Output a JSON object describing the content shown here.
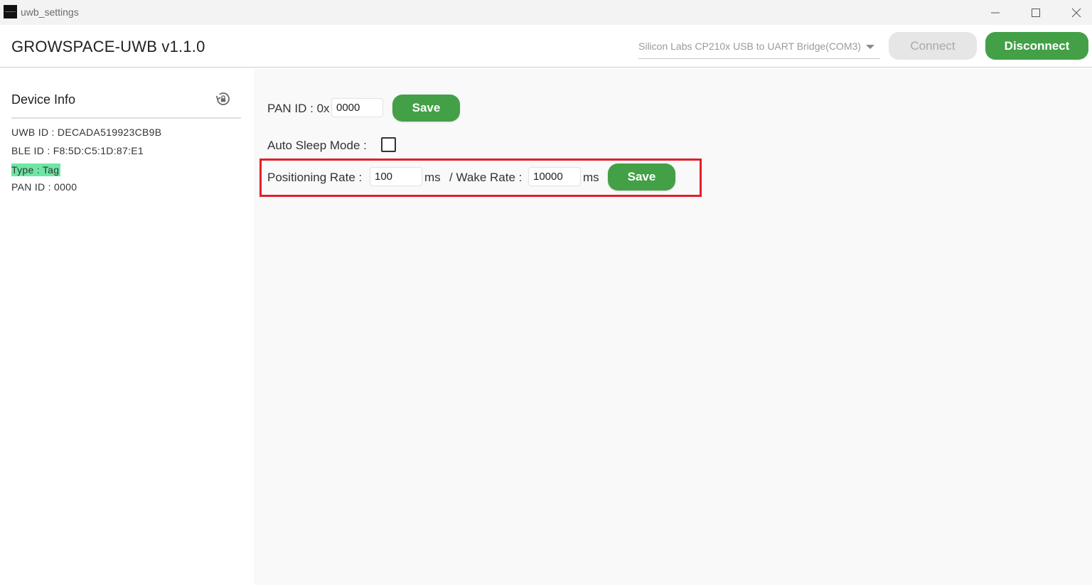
{
  "window": {
    "title": "uwb_settings"
  },
  "header": {
    "app_title": "GROWSPACE-UWB v1.1.0",
    "port_select": {
      "value": "Silicon Labs CP210x USB to UART Bridge(COM3)"
    },
    "connect_label": "Connect",
    "disconnect_label": "Disconnect"
  },
  "sidebar": {
    "title": "Device Info",
    "uwb_id": "UWB ID : DECADA519923CB9B",
    "ble_id": "BLE ID : F8:5D:C5:1D:87:E1",
    "type": "Type : Tag",
    "pan_id": "PAN ID : 0000"
  },
  "main": {
    "pan": {
      "label": "PAN ID : 0x",
      "value": "0000",
      "save_label": "Save"
    },
    "auto_sleep": {
      "label": "Auto Sleep Mode :",
      "checked": false
    },
    "rates": {
      "positioning_label": "Positioning Rate :",
      "positioning_value": "100",
      "positioning_unit": "ms",
      "wake_label": "/ Wake Rate :",
      "wake_value": "10000",
      "wake_unit": "ms",
      "save_label": "Save"
    }
  },
  "colors": {
    "accent_green": "#43a047",
    "type_highlight": "#6ee7a5",
    "annotation_red": "#e0202a"
  },
  "icons": {
    "refresh": "refresh-lock-icon",
    "minimize": "minimize-icon",
    "maximize": "maximize-icon",
    "close": "close-icon",
    "dropdown": "chevron-down-icon"
  }
}
